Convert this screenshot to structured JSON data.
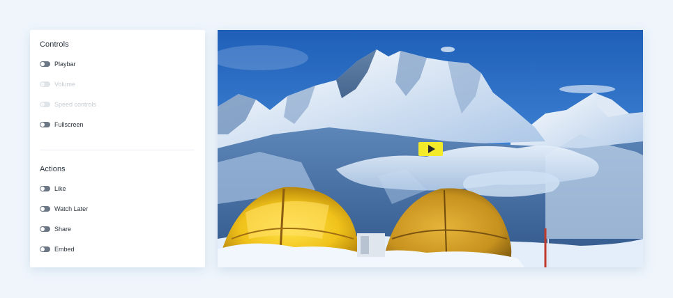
{
  "controls": {
    "title": "Controls",
    "items": [
      {
        "label": "Playbar",
        "enabled": true
      },
      {
        "label": "Volume",
        "enabled": false
      },
      {
        "label": "Speed controls",
        "enabled": false
      },
      {
        "label": "Fullscreen",
        "enabled": true
      }
    ]
  },
  "actions": {
    "title": "Actions",
    "items": [
      {
        "label": "Like",
        "enabled": true
      },
      {
        "label": "Watch Later",
        "enabled": true
      },
      {
        "label": "Share",
        "enabled": true
      },
      {
        "label": "Embed",
        "enabled": true
      }
    ]
  },
  "video": {
    "thumbnail_icon": "mountain-camp-scene",
    "play_icon": "play-icon",
    "accent_color": "#f3ea2a"
  }
}
